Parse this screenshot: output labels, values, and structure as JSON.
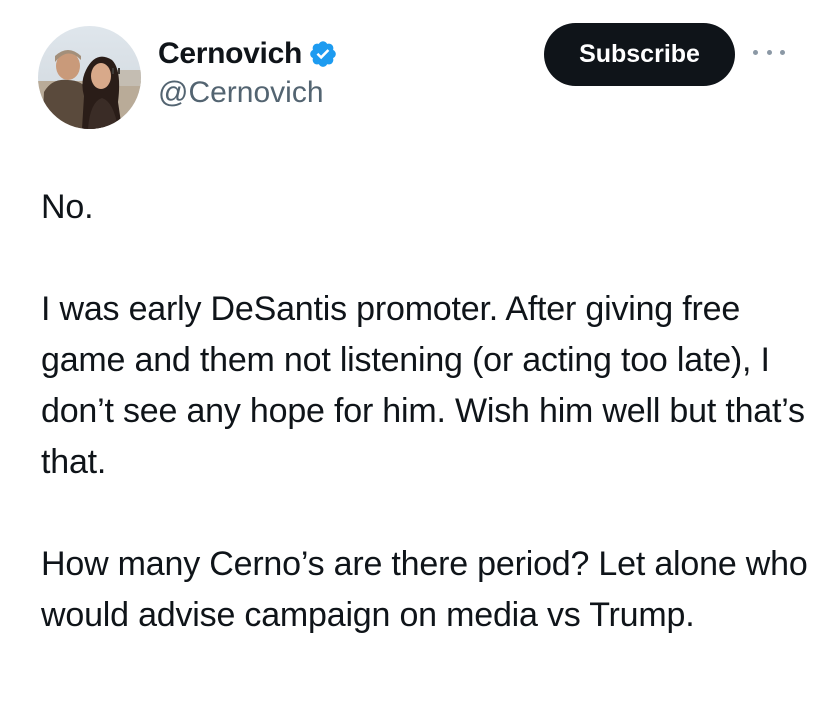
{
  "author": {
    "display_name": "Cernovich",
    "handle": "@Cernovich",
    "verified": true,
    "verified_color": "#1d9bf0"
  },
  "actions": {
    "subscribe_label": "Subscribe",
    "more_icon": "more-horizontal-icon"
  },
  "tweet": {
    "paragraphs": [
      "No.",
      "I was early DeSantis promoter. After giving free game and them not listening (or acting too late), I don’t see any hope for him. Wish him well but that’s that.",
      "How many Cerno’s are there period? Let alone who would advise campaign on media vs Trump."
    ]
  }
}
